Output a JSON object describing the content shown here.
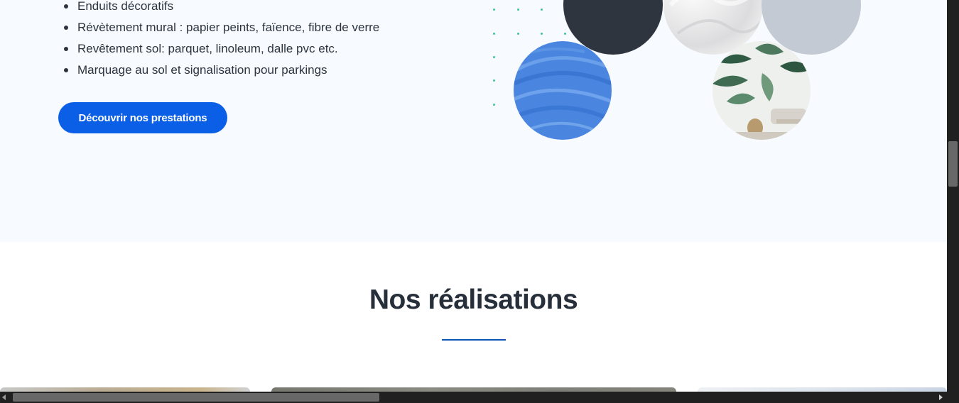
{
  "services": {
    "items": [
      "Enduits décoratifs",
      "Révètement mural : papier peints, faïence, fibre de verre",
      "Revêtement sol: parquet, linoleum, dalle pvc etc.",
      "Marquage au sol et signalisation pour parkings"
    ],
    "cta_label": "Découvrir nos prestations"
  },
  "realisations": {
    "title": "Nos réalisations"
  },
  "colors": {
    "accent": "#0a5fe6",
    "section_background": "#f7fbff",
    "heading": "#27303a",
    "divider": "#0d56b5",
    "dots": "#3cc79a"
  },
  "icons": {
    "scroll_left": "chevron-left-icon",
    "scroll_right": "chevron-right-icon"
  }
}
